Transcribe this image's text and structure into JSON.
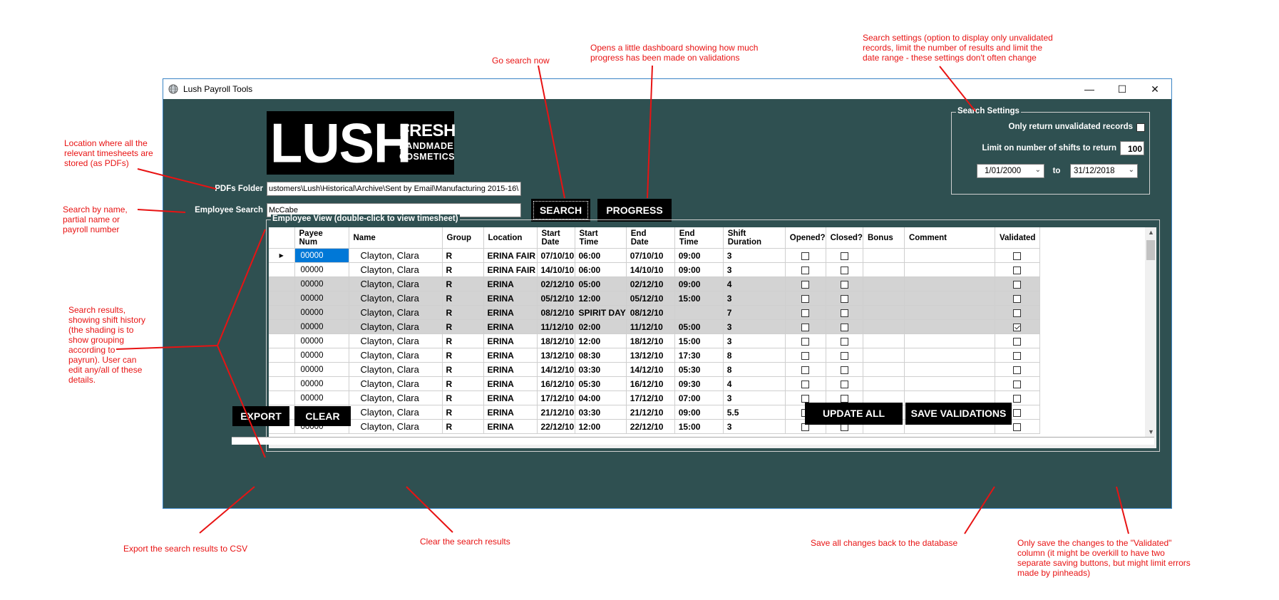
{
  "annotations": {
    "go_search": "Go search now",
    "progress": "Opens a little dashboard showing how much\nprogress has been made on validations",
    "search_settings": "Search settings (option to display only unvalidated\nrecords, limit the number of results and limit the\ndate range - these settings don't often change",
    "location": "Location where all the\nrelevant timesheets are\nstored (as PDFs)",
    "search_by": "Search by name,\npartial name or\npayroll number",
    "results": "Search results,\nshowing shift history\n(the shading is to\nshow grouping\naccording to\npayrun).  User can\nedit any/all of these\ndetails.",
    "export": "Export the search results to CSV",
    "clear": "Clear the search results",
    "update_all": "Save all changes back to the database",
    "save_validations": "Only save the changes to the \"Validated\"\ncolumn (it might be overkill to have two\nseparate saving buttons, but might limit errors\nmade by pinheads)"
  },
  "window": {
    "title": "Lush Payroll Tools",
    "minimize": "—",
    "maximize": "☐",
    "close": "✕"
  },
  "logo": {
    "main": "LUSH",
    "fresh": "FRESH",
    "line1": "HANDMADE",
    "line2": "COSMETICS"
  },
  "form": {
    "pdfs_label": "PDFs Folder",
    "pdfs_value": "ustomers\\Lush\\Historical\\Archive\\Sent by Email\\Manufacturing 2015-16\\",
    "employee_label": "Employee Search",
    "employee_value": "McCabe"
  },
  "buttons": {
    "search": "SEARCH",
    "progress": "PROGRESS",
    "export": "EXPORT",
    "clear": "CLEAR",
    "update_all": "UPDATE ALL",
    "save_validations": "SAVE VALIDATIONS"
  },
  "settings": {
    "legend": "Search Settings",
    "unvalidated_label": "Only return unvalidated records",
    "unvalidated_checked": false,
    "limit_label": "Limit on number of shifts to return",
    "limit_value": "100",
    "date_from": "1/01/2000",
    "to_label": "to",
    "date_to": "31/12/2018"
  },
  "grid": {
    "legend": "Employee View (double-click to view timesheet)",
    "headers": [
      "Payee\nNum",
      "Name",
      "Group",
      "Location",
      "Start\nDate",
      "Start\nTime",
      "End\nDate",
      "End\nTime",
      "Shift\nDuration",
      "Opened?",
      "Closed?",
      "Bonus",
      "Comment",
      "Validated"
    ],
    "rows": [
      {
        "num": "00000",
        "name": "Clayton, Clara",
        "group": "R",
        "location": "ERINA FAIR",
        "start_date": "07/10/10",
        "start_time": "06:00",
        "end_date": "07/10/10",
        "end_time": "09:00",
        "duration": "3",
        "opened": false,
        "closed": false,
        "bonus": "",
        "comment": "",
        "validated": false,
        "shaded": false,
        "current": true
      },
      {
        "num": "00000",
        "name": "Clayton, Clara",
        "group": "R",
        "location": "ERINA FAIR",
        "start_date": "14/10/10",
        "start_time": "06:00",
        "end_date": "14/10/10",
        "end_time": "09:00",
        "duration": "3",
        "opened": false,
        "closed": false,
        "bonus": "",
        "comment": "",
        "validated": false,
        "shaded": false,
        "current": false
      },
      {
        "num": "00000",
        "name": "Clayton, Clara",
        "group": "R",
        "location": "ERINA",
        "start_date": "02/12/10",
        "start_time": "05:00",
        "end_date": "02/12/10",
        "end_time": "09:00",
        "duration": "4",
        "opened": false,
        "closed": false,
        "bonus": "",
        "comment": "",
        "validated": false,
        "shaded": true,
        "current": false
      },
      {
        "num": "00000",
        "name": "Clayton, Clara",
        "group": "R",
        "location": "ERINA",
        "start_date": "05/12/10",
        "start_time": "12:00",
        "end_date": "05/12/10",
        "end_time": "15:00",
        "duration": "3",
        "opened": false,
        "closed": false,
        "bonus": "",
        "comment": "",
        "validated": false,
        "shaded": true,
        "current": false
      },
      {
        "num": "00000",
        "name": "Clayton, Clara",
        "group": "R",
        "location": "ERINA",
        "start_date": "08/12/10",
        "start_time": "SPIRIT DAY",
        "end_date": "08/12/10",
        "end_time": "",
        "duration": "7",
        "opened": false,
        "closed": false,
        "bonus": "",
        "comment": "",
        "validated": false,
        "shaded": true,
        "current": false
      },
      {
        "num": "00000",
        "name": "Clayton, Clara",
        "group": "R",
        "location": "ERINA",
        "start_date": "11/12/10",
        "start_time": "02:00",
        "end_date": "11/12/10",
        "end_time": "05:00",
        "duration": "3",
        "opened": false,
        "closed": false,
        "bonus": "",
        "comment": "",
        "validated": true,
        "shaded": true,
        "current": false
      },
      {
        "num": "00000",
        "name": "Clayton, Clara",
        "group": "R",
        "location": "ERINA",
        "start_date": "18/12/10",
        "start_time": "12:00",
        "end_date": "18/12/10",
        "end_time": "15:00",
        "duration": "3",
        "opened": false,
        "closed": false,
        "bonus": "",
        "comment": "",
        "validated": false,
        "shaded": false,
        "current": false
      },
      {
        "num": "00000",
        "name": "Clayton, Clara",
        "group": "R",
        "location": "ERINA",
        "start_date": "13/12/10",
        "start_time": "08:30",
        "end_date": "13/12/10",
        "end_time": "17:30",
        "duration": "8",
        "opened": false,
        "closed": false,
        "bonus": "",
        "comment": "",
        "validated": false,
        "shaded": false,
        "current": false
      },
      {
        "num": "00000",
        "name": "Clayton, Clara",
        "group": "R",
        "location": "ERINA",
        "start_date": "14/12/10",
        "start_time": "03:30",
        "end_date": "14/12/10",
        "end_time": "05:30",
        "duration": "8",
        "opened": false,
        "closed": false,
        "bonus": "",
        "comment": "",
        "validated": false,
        "shaded": false,
        "current": false
      },
      {
        "num": "00000",
        "name": "Clayton, Clara",
        "group": "R",
        "location": "ERINA",
        "start_date": "16/12/10",
        "start_time": "05:30",
        "end_date": "16/12/10",
        "end_time": "09:30",
        "duration": "4",
        "opened": false,
        "closed": false,
        "bonus": "",
        "comment": "",
        "validated": false,
        "shaded": false,
        "current": false
      },
      {
        "num": "00000",
        "name": "Clayton, Clara",
        "group": "R",
        "location": "ERINA",
        "start_date": "17/12/10",
        "start_time": "04:00",
        "end_date": "17/12/10",
        "end_time": "07:00",
        "duration": "3",
        "opened": false,
        "closed": false,
        "bonus": "",
        "comment": "",
        "validated": false,
        "shaded": false,
        "current": false
      },
      {
        "num": "00000",
        "name": "Clayton, Clara",
        "group": "R",
        "location": "ERINA",
        "start_date": "21/12/10",
        "start_time": "03:30",
        "end_date": "21/12/10",
        "end_time": "09:00",
        "duration": "5.5",
        "opened": false,
        "closed": false,
        "bonus": "",
        "comment": "",
        "validated": false,
        "shaded": false,
        "current": false
      },
      {
        "num": "00000",
        "name": "Clayton, Clara",
        "group": "R",
        "location": "ERINA",
        "start_date": "22/12/10",
        "start_time": "12:00",
        "end_date": "22/12/10",
        "end_time": "15:00",
        "duration": "3",
        "opened": false,
        "closed": false,
        "bonus": "",
        "comment": "",
        "validated": false,
        "shaded": false,
        "current": false
      }
    ]
  },
  "colors": {
    "window_bg": "#2f5051",
    "annotation": "#e81313",
    "row_shade": "#d3d3d3",
    "selection": "#0078d7"
  },
  "icons": {
    "app": "globe-icon",
    "row_pointer": "right-triangle-icon"
  }
}
